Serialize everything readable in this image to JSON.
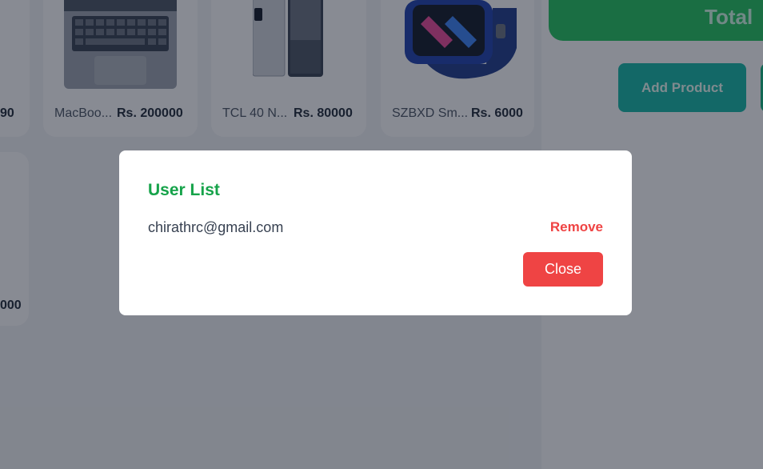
{
  "products": [
    {
      "name": "MacBoo...",
      "price": "Rs. 200000",
      "image": "laptop-image"
    },
    {
      "name": "TCL 40 N...",
      "price": "Rs. 80000",
      "image": "phone-image"
    },
    {
      "name": "SZBXD Sm...",
      "price": "Rs. 6000",
      "image": "smartwatch-image"
    }
  ],
  "partial_prices": [
    "90",
    "000"
  ],
  "stats": {
    "label": "Total"
  },
  "actions": {
    "add_product": "Add Product"
  },
  "modal": {
    "title": "User List",
    "users": [
      {
        "email": "chirathrc@gmail.com",
        "remove_label": "Remove"
      }
    ],
    "close_label": "Close"
  },
  "colors": {
    "accent_green": "#16a34a",
    "danger_red": "#ef4444",
    "teal": "#14b8a6"
  }
}
